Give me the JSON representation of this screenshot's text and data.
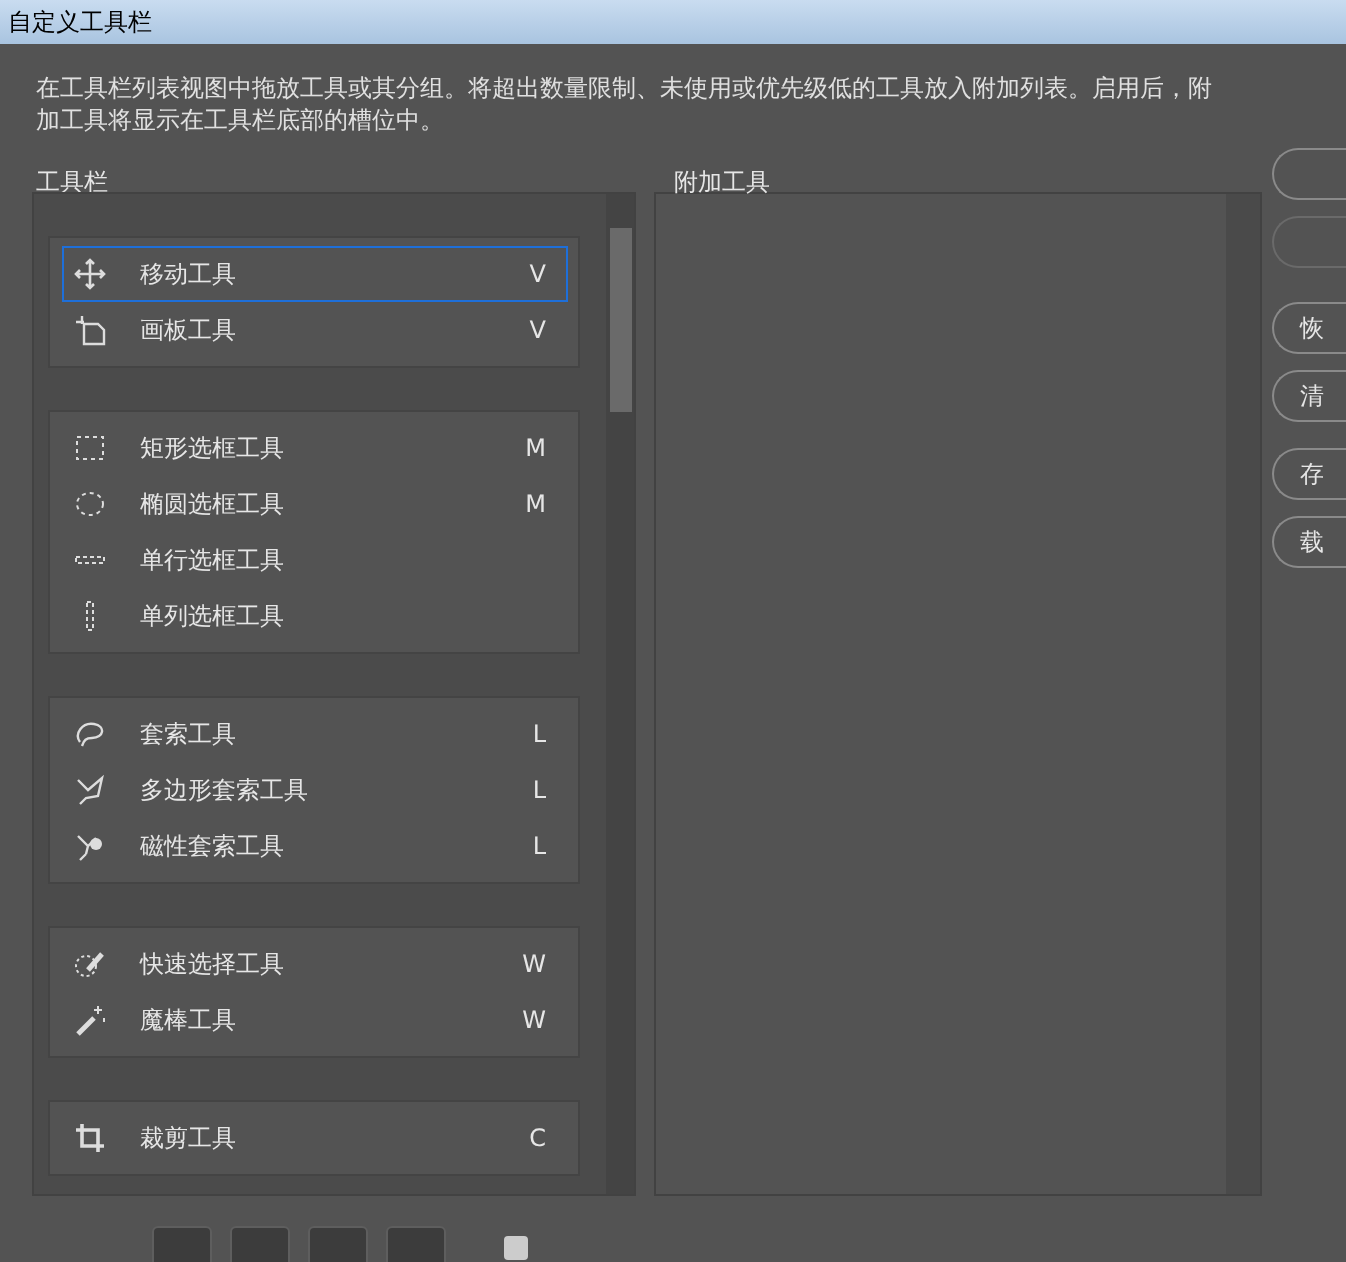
{
  "window": {
    "title": "自定义工具栏"
  },
  "description": "在工具栏列表视图中拖放工具或其分组。将超出数量限制、未使用或优先级低的工具放入附加列表。启用后，附加工具将显示在工具栏底部的槽位中。",
  "toolbar_list": {
    "label": "工具栏",
    "groups": [
      {
        "tools": [
          {
            "kind": "move",
            "name": "移动工具",
            "shortcut": "V",
            "selected": true
          },
          {
            "kind": "artboard",
            "name": "画板工具",
            "shortcut": "V",
            "selected": false
          }
        ]
      },
      {
        "tools": [
          {
            "kind": "rect",
            "name": "矩形选框工具",
            "shortcut": "M",
            "selected": false
          },
          {
            "kind": "ellipse",
            "name": "椭圆选框工具",
            "shortcut": "M",
            "selected": false
          },
          {
            "kind": "row",
            "name": "单行选框工具",
            "selected": false
          },
          {
            "kind": "column",
            "name": "单列选框工具",
            "selected": false
          }
        ]
      },
      {
        "tools": [
          {
            "kind": "lasso",
            "name": "套索工具",
            "shortcut": "L",
            "selected": false
          },
          {
            "kind": "polylasso",
            "name": "多边形套索工具",
            "shortcut": "L",
            "selected": false
          },
          {
            "kind": "maglasso",
            "name": "磁性套索工具",
            "shortcut": "L",
            "selected": false
          }
        ]
      },
      {
        "tools": [
          {
            "kind": "quick",
            "name": "快速选择工具",
            "shortcut": "W",
            "selected": false
          },
          {
            "kind": "wand",
            "name": "魔棒工具",
            "shortcut": "W",
            "selected": false
          }
        ]
      },
      {
        "tools": [
          {
            "kind": "crop",
            "name": "裁剪工具",
            "shortcut": "C",
            "selected": false
          }
        ]
      }
    ]
  },
  "extra_list": {
    "label": "附加工具"
  },
  "side_buttons": [
    {
      "label": "恢"
    },
    {
      "label": "清"
    },
    {
      "label": "存"
    },
    {
      "label": "载"
    }
  ],
  "bottom_bar": {
    "checkbox": {
      "checked": false
    }
  }
}
